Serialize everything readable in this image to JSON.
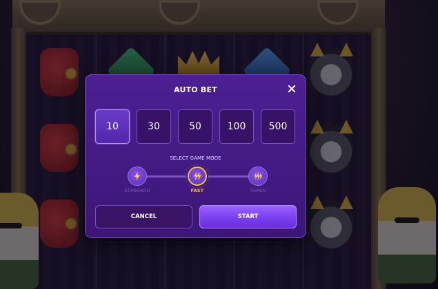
{
  "modal": {
    "title": "AUTO BET",
    "close_icon": "close-icon",
    "amounts": [
      "10",
      "30",
      "50",
      "100",
      "500"
    ],
    "selected_amount": "10",
    "mode_section_label": "SELECT GAME MODE",
    "modes": [
      {
        "label": "STANDARD",
        "icon": "lightning-icon",
        "active": false
      },
      {
        "label": "FAST",
        "icon": "double-lightning-icon",
        "active": true
      },
      {
        "label": "TURBO",
        "icon": "triple-lightning-icon",
        "active": false
      }
    ],
    "cancel_label": "CANCEL",
    "start_label": "START"
  },
  "colors": {
    "modal_bg": "#4d1f93",
    "accent_active": "#f2c24a",
    "start_button": "#8b4fff"
  }
}
